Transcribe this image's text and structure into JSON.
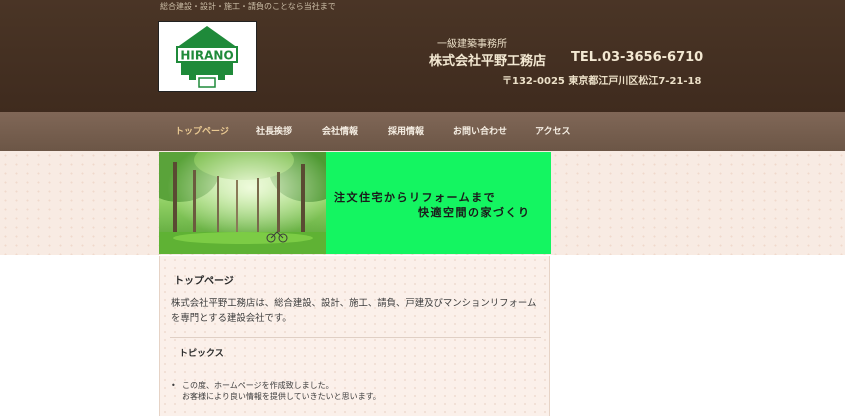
{
  "header": {
    "tagline": "総合建設・設計・施工・請負のことなら当社まで",
    "logo_text": "HIRANO",
    "office_type": "一級建築事務所",
    "company_name": "株式会社平野工務店",
    "tel": "TEL.03-3656-6710",
    "address": "〒132-0025 東京都江戸川区松江7-21-18"
  },
  "nav": {
    "items": [
      {
        "label": "トップページ"
      },
      {
        "label": "社長挨拶"
      },
      {
        "label": "会社情報"
      },
      {
        "label": "採用情報"
      },
      {
        "label": "お問い合わせ"
      },
      {
        "label": "アクセス"
      }
    ],
    "active_index": 0
  },
  "hero": {
    "line1": "注文住宅からリフォームまで",
    "line2": "快適空間の家づくり",
    "panel_color": "#14f561"
  },
  "main": {
    "heading": "トップページ",
    "intro": "株式会社平野工務店は、総合建設、設計、施工、請負、戸建及びマンションリフォームを専門とする建設会社です。",
    "topics_heading": "トピックス",
    "topics": [
      {
        "bullet": "•",
        "line1": "この度、ホームページを作成致しました。",
        "line2": "お客様により良い情報を提供していきたいと思います。"
      }
    ]
  },
  "colors": {
    "header_bg": "#45301f",
    "nav_bg": "#776050",
    "logo_green": "#1f8a3a"
  }
}
